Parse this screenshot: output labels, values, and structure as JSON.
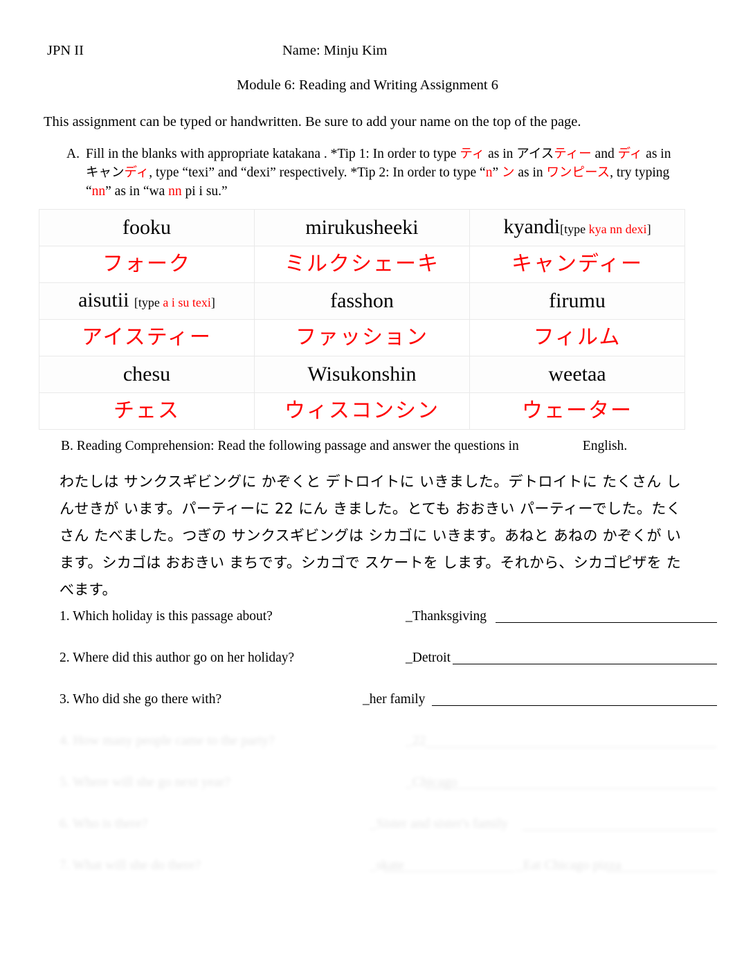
{
  "header": {
    "course": "JPN II",
    "name_label": "Name: Minju Kim",
    "title": "Module 6: Reading and Writing Assignment 6",
    "intro": "This assignment can be typed or handwritten. Be sure to add your name on the top of the page."
  },
  "section_a": {
    "letter": "A.",
    "t1": "Fill in the blanks with appropriate katakana  . *Tip 1: In order to type ",
    "k1": "ティ",
    "t2": " as in ",
    "k2": "アイス",
    "k3": "ティー",
    "t3": "  and ",
    "k4": "ディ",
    "t4": "   as in ",
    "k5": "キャン",
    "k6": "ディ",
    "t5": ", type “texi” and “dexi” respectively.    *Tip 2: In order to type “",
    "r1": "n",
    "t6": "” ",
    "k7": "ン",
    "t7": " as in ",
    "k8": "ワンピース",
    "t8": ", try typing “",
    "r2": "nn",
    "t9": "” as in “wa ",
    "r3": "nn",
    "t10": " pi i su.”"
  },
  "table": {
    "rows": [
      {
        "type": "romaji",
        "cells": [
          {
            "main": "fooku",
            "hint_pre": "",
            "hint_red": "",
            "hint_post": ""
          },
          {
            "main": "mirukusheeki",
            "hint_pre": "",
            "hint_red": "",
            "hint_post": ""
          },
          {
            "main": "kyandi",
            "hint_pre": "[type ",
            "hint_red": "kya nn dexi",
            "hint_post": "]"
          }
        ]
      },
      {
        "type": "kana",
        "cells": [
          {
            "main": "フォーク"
          },
          {
            "main": "ミルクシェーキ"
          },
          {
            "main": "キャンディー"
          }
        ]
      },
      {
        "type": "romaji",
        "cells": [
          {
            "main": "aisutii ",
            "hint_pre": "[type ",
            "hint_red": " a i su texi",
            "hint_post": "]"
          },
          {
            "main": "fasshon",
            "hint_pre": "",
            "hint_red": "",
            "hint_post": ""
          },
          {
            "main": "firumu",
            "hint_pre": "",
            "hint_red": "",
            "hint_post": ""
          }
        ]
      },
      {
        "type": "kana",
        "cells": [
          {
            "main": "アイスティー"
          },
          {
            "main": "ファッション"
          },
          {
            "main": "フィルム"
          }
        ]
      },
      {
        "type": "romaji",
        "cells": [
          {
            "main": "chesu",
            "hint_pre": "",
            "hint_red": "",
            "hint_post": ""
          },
          {
            "main": "Wisukonshin",
            "hint_pre": "",
            "hint_red": "",
            "hint_post": ""
          },
          {
            "main": "weetaa",
            "hint_pre": "",
            "hint_red": "",
            "hint_post": ""
          }
        ]
      },
      {
        "type": "kana",
        "cells": [
          {
            "main": "チェス"
          },
          {
            "main": "ウィスコンシン"
          },
          {
            "main": "ウェーター"
          }
        ]
      }
    ]
  },
  "section_b": {
    "lead": "B. Reading Comprehension: Read the following passage and answer the questions in",
    "english_word": "English",
    "period": ".",
    "passage": "わたしは サンクスギビングに かぞくと デトロイトに いきました。デトロイトに たくさん しんせきが います。パーティーに  22 にん きました。とても おおきい パーティーでした。たくさん たべました。つぎの サンクスギビングは シカゴに いきます。あねと あねの かぞくが います。シカゴは おおきい まちです。シカゴで スケートを します。それから、シカゴピザを たべます。"
  },
  "questions": [
    {
      "number": "1.",
      "text": "1. Which holiday is this passage about?",
      "answer": "_Thanksgiving",
      "visible": true
    },
    {
      "number": "2.",
      "text": "2. Where did this author go on her holiday?",
      "answer": "_Detroit",
      "visible": true
    },
    {
      "number": "3.",
      "text": "3. Who did she go there with?",
      "answer": "_her family",
      "visible": true
    },
    {
      "number": "4.",
      "text": "4. How many people came to the party?",
      "answer": "_22",
      "visible": false
    },
    {
      "number": "5.",
      "text": "5. Where will she go next year?",
      "answer": "_Chicago",
      "visible": false
    },
    {
      "number": "6.",
      "text": "6. Who is there?",
      "answer": "_Sister and sister's family",
      "visible": false
    },
    {
      "number": "7.",
      "text": "7. What will she do there?",
      "answer": "_skate",
      "answer2": "_Eat Chicago pizza",
      "visible": false
    }
  ],
  "colors": {
    "accent_red": "#FF0000",
    "text": "#000000",
    "table_border": "#E9E9E9"
  }
}
